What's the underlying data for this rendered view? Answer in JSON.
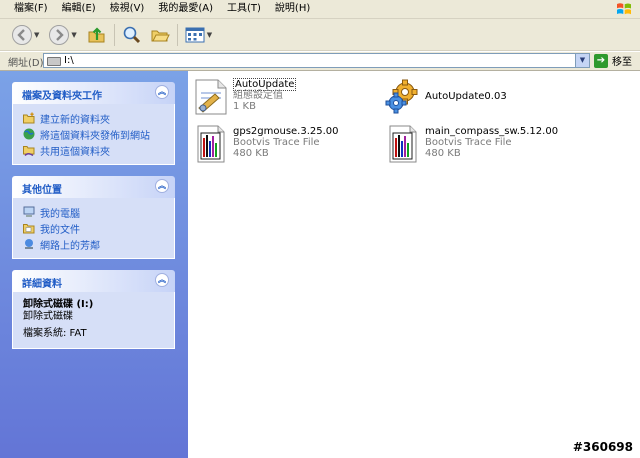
{
  "menu": [
    "檔案(F)",
    "編輯(E)",
    "檢視(V)",
    "我的最愛(A)",
    "工具(T)",
    "說明(H)"
  ],
  "toolbar": {
    "icons": [
      "back-icon",
      "forward-icon",
      "up-folder-icon",
      "search-icon",
      "folders-icon",
      "views-icon"
    ]
  },
  "address": {
    "label": "網址(D)",
    "value": "I:\\",
    "go_label": "移至"
  },
  "tasks": {
    "title": "檔案及資料夾工作",
    "items": [
      "建立新的資料夾",
      "將這個資料夾發佈到網站",
      "共用這個資料夾"
    ]
  },
  "other": {
    "title": "其他位置",
    "items": [
      "我的電腦",
      "我的文件",
      "網路上的芳鄰"
    ]
  },
  "details": {
    "title": "詳細資料",
    "name": "卸除式磁碟 (I:)",
    "type": "卸除式磁碟",
    "fs": "檔案系統: FAT"
  },
  "files": [
    {
      "name": "AutoUpdate",
      "type": "組態設定值",
      "size": "1 KB",
      "icon": "config-file-icon"
    },
    {
      "name": "AutoUpdate0.03",
      "type": "",
      "size": "",
      "icon": "gears-exe-icon"
    },
    {
      "name": "gps2gmouse.3.25.00",
      "type": "Bootvis Trace File",
      "size": "480 KB",
      "icon": "bootvis-file-icon"
    },
    {
      "name": "main_compass_sw.5.12.00",
      "type": "Bootvis Trace File",
      "size": "480 KB",
      "icon": "bootvis-file-icon"
    }
  ],
  "watermark": "#360698"
}
